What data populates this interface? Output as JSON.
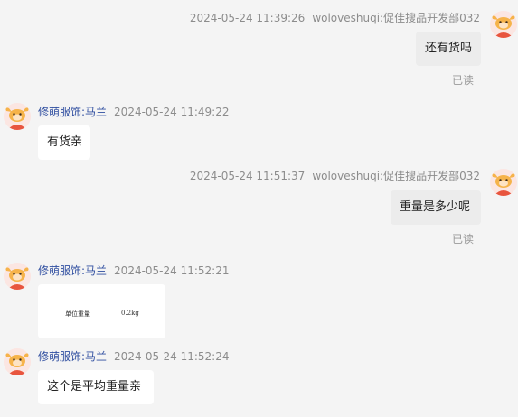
{
  "messages": [
    {
      "sender": "woloveshuqi:促佳搜品开发部032",
      "time": "2024-05-24 11:39:26",
      "text": "还有货吗",
      "status": "已读"
    },
    {
      "sender": "修萌服饰:马兰",
      "time": "2024-05-24 11:49:22",
      "text": "有货亲"
    },
    {
      "sender": "woloveshuqi:促佳搜品开发部032",
      "time": "2024-05-24 11:51:37",
      "text": "重量是多少呢",
      "status": "已读"
    },
    {
      "sender": "修萌服饰:马兰",
      "time": "2024-05-24 11:52:21",
      "image": {
        "label": "单位重量",
        "value": "0.2kg"
      }
    },
    {
      "sender": "修萌服饰:马兰",
      "time": "2024-05-24 11:52:24",
      "text": "这个是平均重量亲"
    }
  ],
  "colors": {
    "background": "#f4f4f4",
    "seller_name": "#2f4ea0",
    "sent_bubble": "#ececec",
    "received_bubble": "#ffffff"
  }
}
